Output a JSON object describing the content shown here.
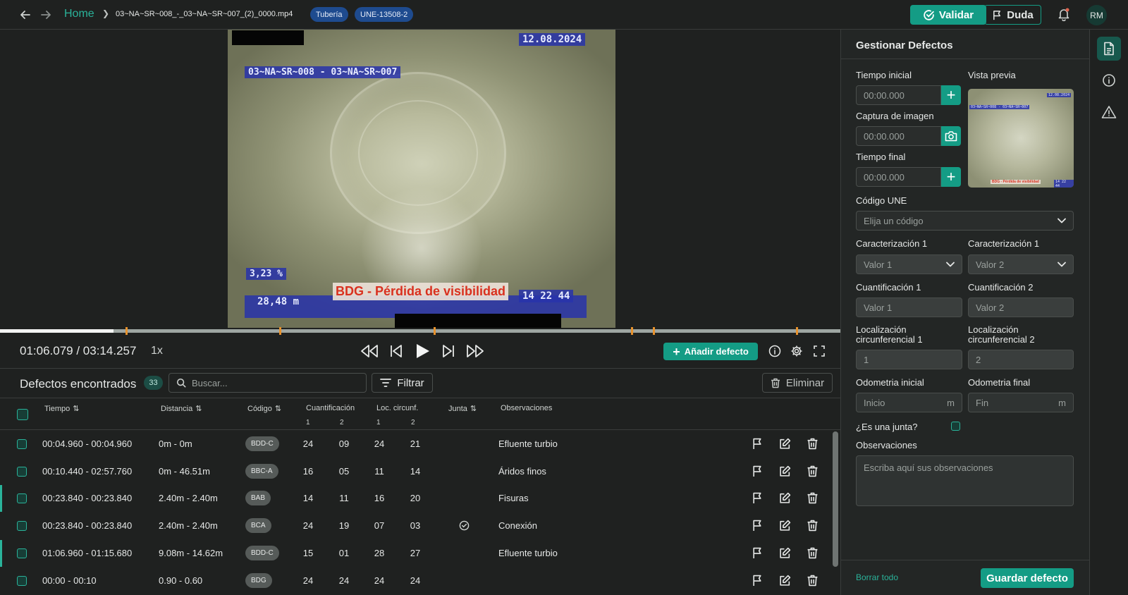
{
  "topbar": {
    "home": "Home",
    "file": "03~NA~SR~008_-_03~NA~SR~007_(2)_0000.mp4",
    "tags": [
      "Tubería",
      "UNE-13508-2"
    ],
    "validar": "Validar",
    "duda": "Duda",
    "avatar": "RM"
  },
  "video": {
    "osd_date": "12.08.2024",
    "osd_section": "03~NA~SR~008 - 03~NA~SR~007",
    "osd_percent": "3,23 %",
    "osd_distance": "28,48 m",
    "osd_time": "14 22 44",
    "defect_label": "BDG - Pérdida de visibilidad",
    "progress_fraction": 0.135,
    "marker_fractions": [
      0.15,
      0.333,
      0.517,
      0.752,
      0.778,
      0.948
    ]
  },
  "controls": {
    "time": "01:06.079 / 03:14.257",
    "speed": "1x",
    "add_defect": "Añadir defecto"
  },
  "defects": {
    "title": "Defectos encontrados",
    "count": "33",
    "search_placeholder": "Buscar...",
    "filter": "Filtrar",
    "delete": "Eliminar",
    "columns": {
      "time": "Tiempo",
      "distance": "Distancia",
      "code": "Código",
      "quant": "Cuantificación",
      "quant_1": "1",
      "quant_2": "2",
      "loc": "Loc. circunf.",
      "loc_1": "1",
      "loc_2": "2",
      "junta": "Junta",
      "obs": "Observaciones"
    },
    "rows": [
      {
        "time": "00:04.960 - 00:04.960",
        "distance": "0m - 0m",
        "code": "BDD-C",
        "q1": "24",
        "q2": "09",
        "l1": "24",
        "l2": "21",
        "junta": false,
        "obs": "Efluente turbio",
        "accent": false
      },
      {
        "time": "00:10.440 - 02:57.760",
        "distance": "0m - 46.51m",
        "code": "BBC-A",
        "q1": "16",
        "q2": "05",
        "l1": "11",
        "l2": "14",
        "junta": false,
        "obs": "Áridos finos",
        "accent": false
      },
      {
        "time": "00:23.840 - 00:23.840",
        "distance": "2.40m - 2.40m",
        "code": "BAB",
        "q1": "14",
        "q2": "11",
        "l1": "16",
        "l2": "20",
        "junta": false,
        "obs": "Fisuras",
        "accent": true
      },
      {
        "time": "00:23.840 - 00:23.840",
        "distance": "2.40m - 2.40m",
        "code": "BCA",
        "q1": "24",
        "q2": "19",
        "l1": "07",
        "l2": "03",
        "junta": true,
        "obs": "Conexión",
        "accent": false
      },
      {
        "time": "01:06.960 - 01:15.680",
        "distance": "9.08m - 14.62m",
        "code": "BDD-C",
        "q1": "15",
        "q2": "01",
        "l1": "28",
        "l2": "27",
        "junta": false,
        "obs": "Efluente turbio",
        "accent": true
      },
      {
        "time": "00:00 - 00:10",
        "distance": "0.90 - 0.60",
        "code": "BDG",
        "q1": "24",
        "q2": "24",
        "l1": "24",
        "l2": "24",
        "junta": false,
        "obs": "",
        "accent": false
      }
    ]
  },
  "panel": {
    "title": "Gestionar Defectos",
    "tiempo_inicial": "Tiempo inicial",
    "tiempo_inicial_val": "00:00.000",
    "captura": "Captura de imagen",
    "captura_val": "00:00.000",
    "tiempo_final": "Tiempo final",
    "tiempo_final_val": "00:00.000",
    "vista_previa": "Vista previa",
    "codigo_une": "Código UNE",
    "codigo_placeholder": "Elija un código",
    "carac1": "Caracterización 1",
    "carac2": "Caracterización 1",
    "carac1_val": "Valor 1",
    "carac2_val": "Valor 2",
    "cuant1": "Cuantificación 1",
    "cuant2": "Cuantificación 2",
    "cuant1_ph": "Valor 1",
    "cuant2_ph": "Valor 2",
    "loc1_a": "Localización",
    "loc1_b": "circunferencial 1",
    "loc2_a": "Localización",
    "loc2_b": "circunferencial 2",
    "loc1_ph": "1",
    "loc2_ph": "2",
    "odo_ini": "Odometria inicial",
    "odo_fin": "Odometria final",
    "odo_ini_ph": "Inicio",
    "odo_fin_ph": "Fin",
    "unit": "m",
    "junta_q": "¿Es una junta?",
    "observaciones": "Observaciones",
    "obs_ph": "Escriba aquí sus observaciones",
    "borrar": "Borrar todo",
    "guardar": "Guardar defecto",
    "preview_osd_date": "12.08.2024",
    "preview_osd_section": "03~NA~SR~008 - 03~NA~SR~007",
    "preview_label": "BDG - Pérdida de visibilidad",
    "preview_osd_time": "14 22 44"
  },
  "colors": {
    "accent": "#149c85",
    "background": "#1f2120",
    "marker": "#e8922c"
  }
}
